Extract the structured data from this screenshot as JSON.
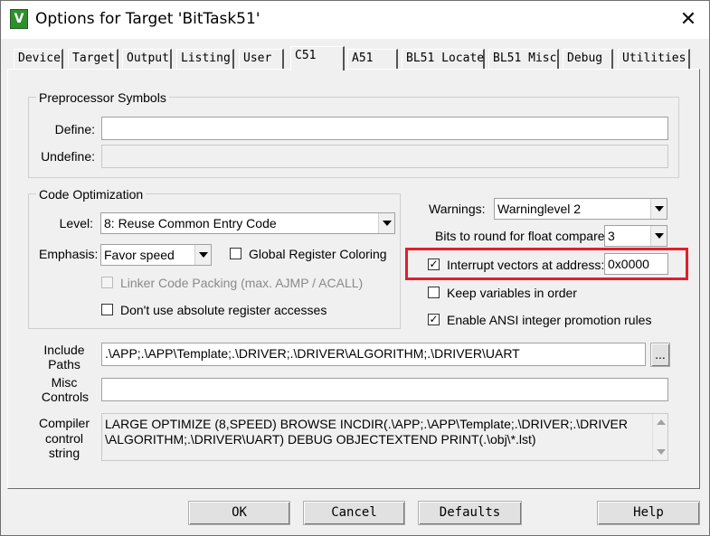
{
  "window": {
    "title": "Options for Target 'BitTask51'",
    "app_icon": "V",
    "close_glyph": "✕"
  },
  "tabs": [
    {
      "label": "Device"
    },
    {
      "label": "Target"
    },
    {
      "label": "Output"
    },
    {
      "label": "Listing"
    },
    {
      "label": "User"
    },
    {
      "label": "C51"
    },
    {
      "label": "A51"
    },
    {
      "label": "BL51 Locate"
    },
    {
      "label": "BL51 Misc"
    },
    {
      "label": "Debug"
    },
    {
      "label": "Utilities"
    }
  ],
  "active_tab": "C51",
  "preprocessor": {
    "title": "Preprocessor Symbols",
    "define_label": "Define:",
    "define_value": "",
    "undefine_label": "Undefine:",
    "undefine_value": ""
  },
  "code_optimization": {
    "title": "Code Optimization",
    "level_label": "Level:",
    "level_value": "8: Reuse Common Entry Code",
    "emphasis_label": "Emphasis:",
    "emphasis_value": "Favor speed",
    "global_register_label": "Global Register Coloring",
    "global_register_checked": false,
    "linker_packing_label": "Linker Code Packing (max. AJMP / ACALL)",
    "linker_packing_checked": false,
    "no_absolute_label": "Don't use absolute register accesses",
    "no_absolute_checked": false
  },
  "right_options": {
    "warnings_label": "Warnings:",
    "warnings_value": "Warninglevel 2",
    "bits_label": "Bits to round for float compare:",
    "bits_value": "3",
    "interrupt_label": "Interrupt vectors at address:",
    "interrupt_checked": true,
    "interrupt_value": "0x0000",
    "keep_vars_label": "Keep variables in order",
    "keep_vars_checked": false,
    "ansi_label": "Enable ANSI integer promotion rules",
    "ansi_checked": true
  },
  "paths": {
    "include_label_1": "Include",
    "include_label_2": "Paths",
    "include_value": ".\\APP;.\\APP\\Template;.\\DRIVER;.\\DRIVER\\ALGORITHM;.\\DRIVER\\UART",
    "browse_label": "...",
    "misc_label_1": "Misc",
    "misc_label_2": "Controls",
    "misc_value": "",
    "compiler_label_1": "Compiler",
    "compiler_label_2": "control",
    "compiler_label_3": "string",
    "compiler_line_1": "LARGE OPTIMIZE (8,SPEED) BROWSE INCDIR(.\\APP;.\\APP\\Template;.\\DRIVER;.\\DRIVER",
    "compiler_line_2": "\\ALGORITHM;.\\DRIVER\\UART) DEBUG OBJECTEXTEND PRINT(.\\obj\\*.lst)"
  },
  "buttons": {
    "ok": "OK",
    "cancel": "Cancel",
    "defaults": "Defaults",
    "help": "Help"
  },
  "check_glyph": "✓",
  "colors": {
    "highlight": "#e21e2e",
    "dialog_bg": "#f0f0f0"
  }
}
